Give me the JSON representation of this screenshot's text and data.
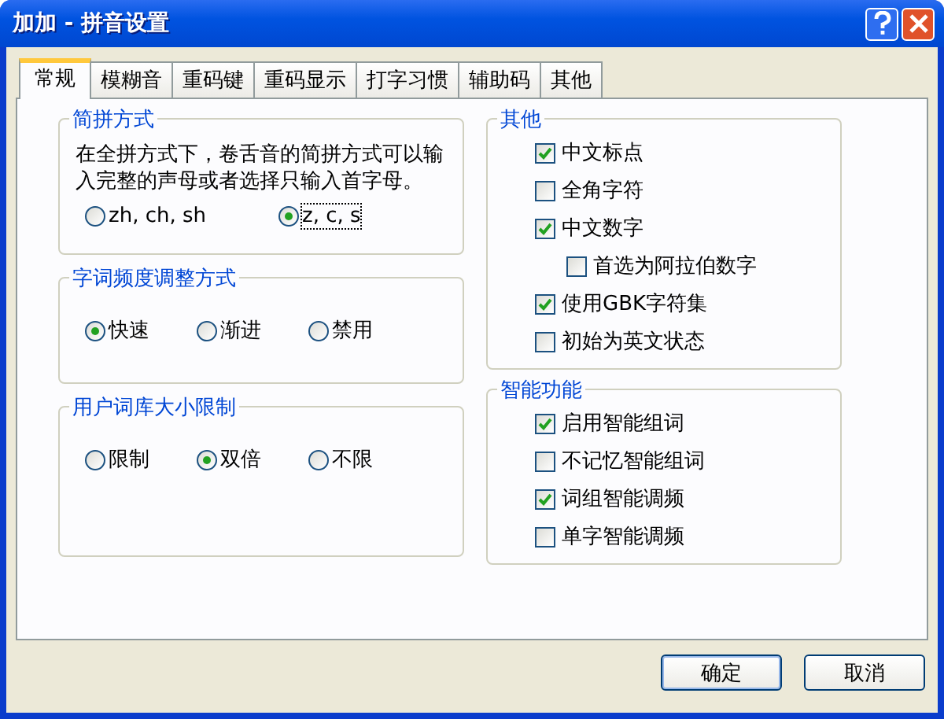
{
  "window": {
    "title": "加加 - 拼音设置"
  },
  "tabs": [
    {
      "label": "常规",
      "selected": true
    },
    {
      "label": "模糊音",
      "selected": false
    },
    {
      "label": "重码键",
      "selected": false
    },
    {
      "label": "重码显示",
      "selected": false
    },
    {
      "label": "打字习惯",
      "selected": false
    },
    {
      "label": "辅助码",
      "selected": false
    },
    {
      "label": "其他",
      "selected": false
    }
  ],
  "left_groups": [
    {
      "title": "简拼方式",
      "description": "在全拼方式下，卷舌音的简拼方式可以输入完整的声母或者选择只输入首字母。",
      "options": [
        {
          "label": "zh, ch, sh",
          "selected": false
        },
        {
          "label": "z, c, s",
          "selected": true
        }
      ]
    },
    {
      "title": "字词频度调整方式",
      "options": [
        {
          "label": "快速",
          "selected": true
        },
        {
          "label": "渐进",
          "selected": false
        },
        {
          "label": "禁用",
          "selected": false
        }
      ]
    },
    {
      "title": "用户词库大小限制",
      "options": [
        {
          "label": "限制",
          "selected": false
        },
        {
          "label": "双倍",
          "selected": true
        },
        {
          "label": "不限",
          "selected": false
        }
      ]
    }
  ],
  "right_groups": [
    {
      "title": "其他",
      "items": [
        {
          "label": "中文标点",
          "checked": true
        },
        {
          "label": "全角字符",
          "checked": false
        },
        {
          "label": "中文数字",
          "checked": true,
          "children": [
            {
              "label": "首选为阿拉伯数字",
              "checked": false
            }
          ]
        },
        {
          "label": "使用GBK字符集",
          "checked": true
        },
        {
          "label": "初始为英文状态",
          "checked": false
        }
      ]
    },
    {
      "title": "智能功能",
      "items": [
        {
          "label": "启用智能组词",
          "checked": true
        },
        {
          "label": "不记忆智能组词",
          "checked": false
        },
        {
          "label": "词组智能调频",
          "checked": true
        },
        {
          "label": "单字智能调频",
          "checked": false
        }
      ]
    }
  ],
  "buttons": [
    "确定",
    "取消"
  ]
}
